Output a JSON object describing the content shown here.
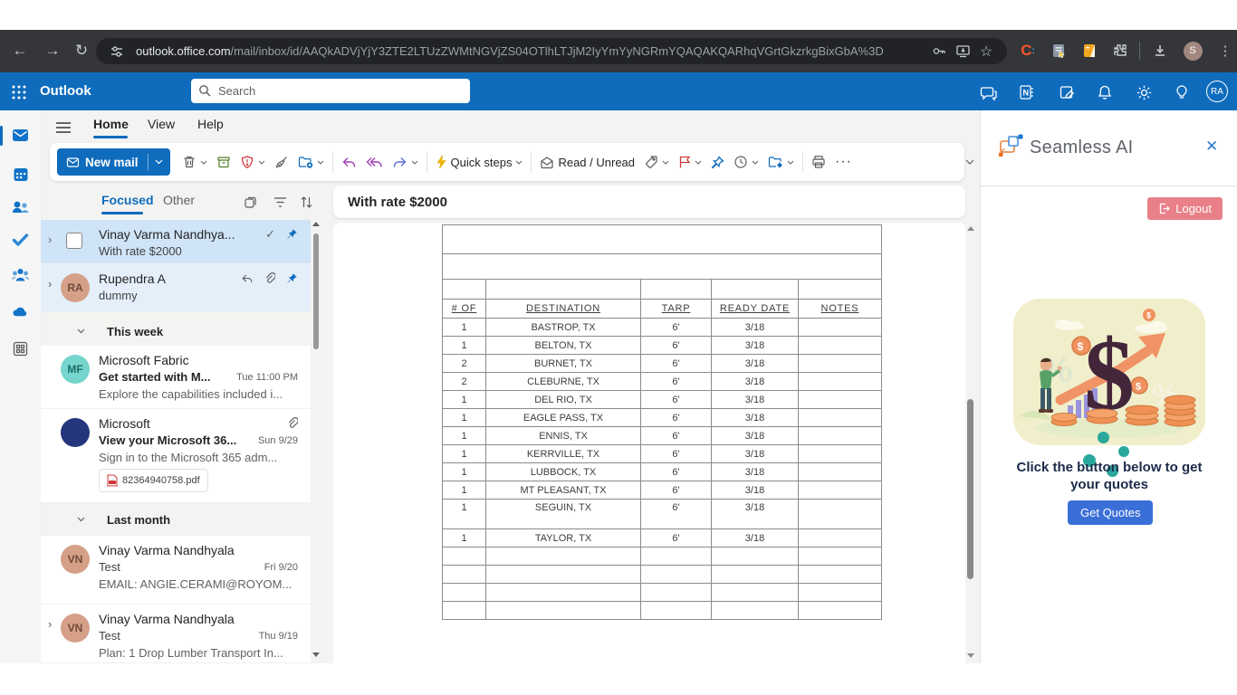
{
  "browser": {
    "url_host": "outlook.office.com",
    "url_path": "/mail/inbox/id/AAQkADVjYjY3ZTE2LTUzZWMtNGVjZS04OTlhLTJjM2IyYmYyNGRmYQAQAKQARhqVGrtGkzrkgBixGbA%3D",
    "extension_c_label": "C",
    "profile_initial": "S"
  },
  "outlook_header": {
    "app_name": "Outlook",
    "search_placeholder": "Search",
    "avatar_initials": "RA"
  },
  "menu_tabs": {
    "home": "Home",
    "view": "View",
    "help": "Help",
    "active": "Home"
  },
  "ribbon": {
    "new_mail_label": "New mail",
    "quick_steps_label": "Quick steps",
    "read_unread_label": "Read / Unread",
    "more_label": "···"
  },
  "mail_list": {
    "tabs": {
      "focused": "Focused",
      "other": "Other"
    },
    "items": [
      {
        "sender": "Vinay Varma Nandhya...",
        "subject": "With rate $2000"
      },
      {
        "sender": "Rupendra A",
        "avatar": "RA",
        "subject": "dummy"
      },
      {
        "label": "This week"
      },
      {
        "sender": "Microsoft Fabric",
        "avatar": "MF",
        "subject": "Get started with M...",
        "date": "Tue 11:00 PM",
        "preview": "Explore the capabilities included i..."
      },
      {
        "sender": "Microsoft",
        "subject": "View your Microsoft 36...",
        "date": "Sun 9/29",
        "preview": "Sign in to the Microsoft 365 adm...",
        "attachment": "82364940758.pdf"
      },
      {
        "label": "Last month"
      },
      {
        "sender": "Vinay Varma Nandhyala",
        "avatar": "VN",
        "subject": "Test",
        "date": "Fri 9/20",
        "preview": "EMAIL: ANGIE.CERAMI@ROYOM..."
      },
      {
        "sender": "Vinay Varma Nandhyala",
        "avatar": "VN",
        "subject": "Test",
        "date": "Thu 9/19",
        "preview": "Plan: 1 Drop Lumber Transport In..."
      }
    ]
  },
  "reading_pane": {
    "subject": "With rate $2000",
    "table": {
      "headers": [
        "# OF",
        "DESTINATION",
        "TARP",
        "READY DATE",
        "NOTES"
      ],
      "rows": [
        [
          "1",
          "BASTROP, TX",
          "6'",
          "3/18",
          ""
        ],
        [
          "1",
          "BELTON, TX",
          "6'",
          "3/18",
          ""
        ],
        [
          "2",
          "BURNET, TX",
          "6'",
          "3/18",
          ""
        ],
        [
          "2",
          "CLEBURNE, TX",
          "6'",
          "3/18",
          ""
        ],
        [
          "1",
          "DEL RIO, TX",
          "6'",
          "3/18",
          ""
        ],
        [
          "1",
          "EAGLE PASS, TX",
          "6'",
          "3/18",
          ""
        ],
        [
          "1",
          "ENNIS, TX",
          "6'",
          "3/18",
          ""
        ],
        [
          "1",
          "KERRVILLE, TX",
          "6'",
          "3/18",
          ""
        ],
        [
          "1",
          "LUBBOCK, TX",
          "6'",
          "3/18",
          ""
        ],
        [
          "1",
          "MT PLEASANT, TX",
          "6'",
          "3/18",
          ""
        ],
        [
          "1",
          "SEGUIN, TX",
          "6'",
          "3/18",
          ""
        ],
        [
          "1",
          "TAYLOR, TX",
          "6'",
          "3/18",
          ""
        ]
      ],
      "empty_rows": 4
    }
  },
  "seamless_panel": {
    "title": "Seamless AI",
    "logout_label": "Logout",
    "instruction_line1": "Click the button below to get",
    "instruction_line2": "your quotes",
    "get_quotes_label": "Get Quotes"
  },
  "colors": {
    "outlook_blue": "#0f6cbd",
    "chrome_bg": "#35363a",
    "selected_mail_bg": "#cfe4f7",
    "pinned_mail_bg": "#e4effa",
    "logout_pink": "#e98089",
    "get_quotes_blue": "#3a6fd8",
    "illustration_bg": "#f1efcb",
    "teal_dot": "#2aa79b"
  }
}
